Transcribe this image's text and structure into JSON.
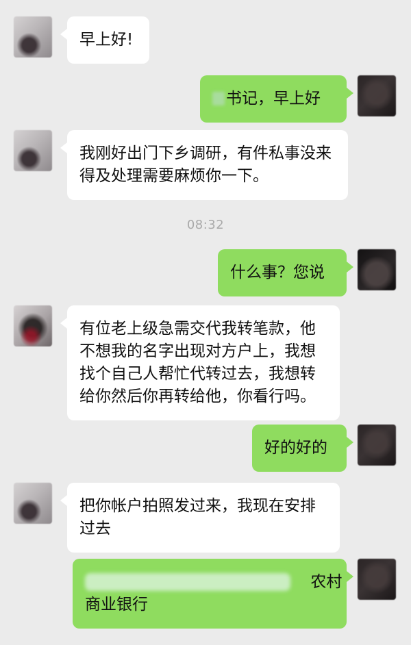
{
  "messages": [
    {
      "side": "in",
      "text": "早上好!"
    },
    {
      "side": "out",
      "text": "书记，早上好",
      "redacted_prefix": true
    },
    {
      "side": "in",
      "text": "我刚好出门下乡调研，有件私事没来得及处理需要麻烦你一下。"
    },
    {
      "type": "timestamp",
      "text": "08:32"
    },
    {
      "side": "out",
      "text": "什么事？您说"
    },
    {
      "side": "in",
      "text": "有位老上级急需交代我转笔款，他不想我的名字出现对方户上，我想找个自己人帮忙代转过去，我想转给你然后你再转给他，你看行吗。"
    },
    {
      "side": "out",
      "text": "好的好的"
    },
    {
      "side": "in",
      "text": "把你帐户拍照发过来，我现在安排过去"
    },
    {
      "side": "out",
      "text_suffix_1": "农村",
      "text_line_2": "商业银行",
      "redacted_prefix": true
    }
  ],
  "colors": {
    "background": "#ebebeb",
    "incoming_bubble": "#ffffff",
    "outgoing_bubble": "#8fdc5f",
    "timestamp_text": "#a9a9a9"
  },
  "icons": {
    "avatar": "avatar-icon"
  }
}
